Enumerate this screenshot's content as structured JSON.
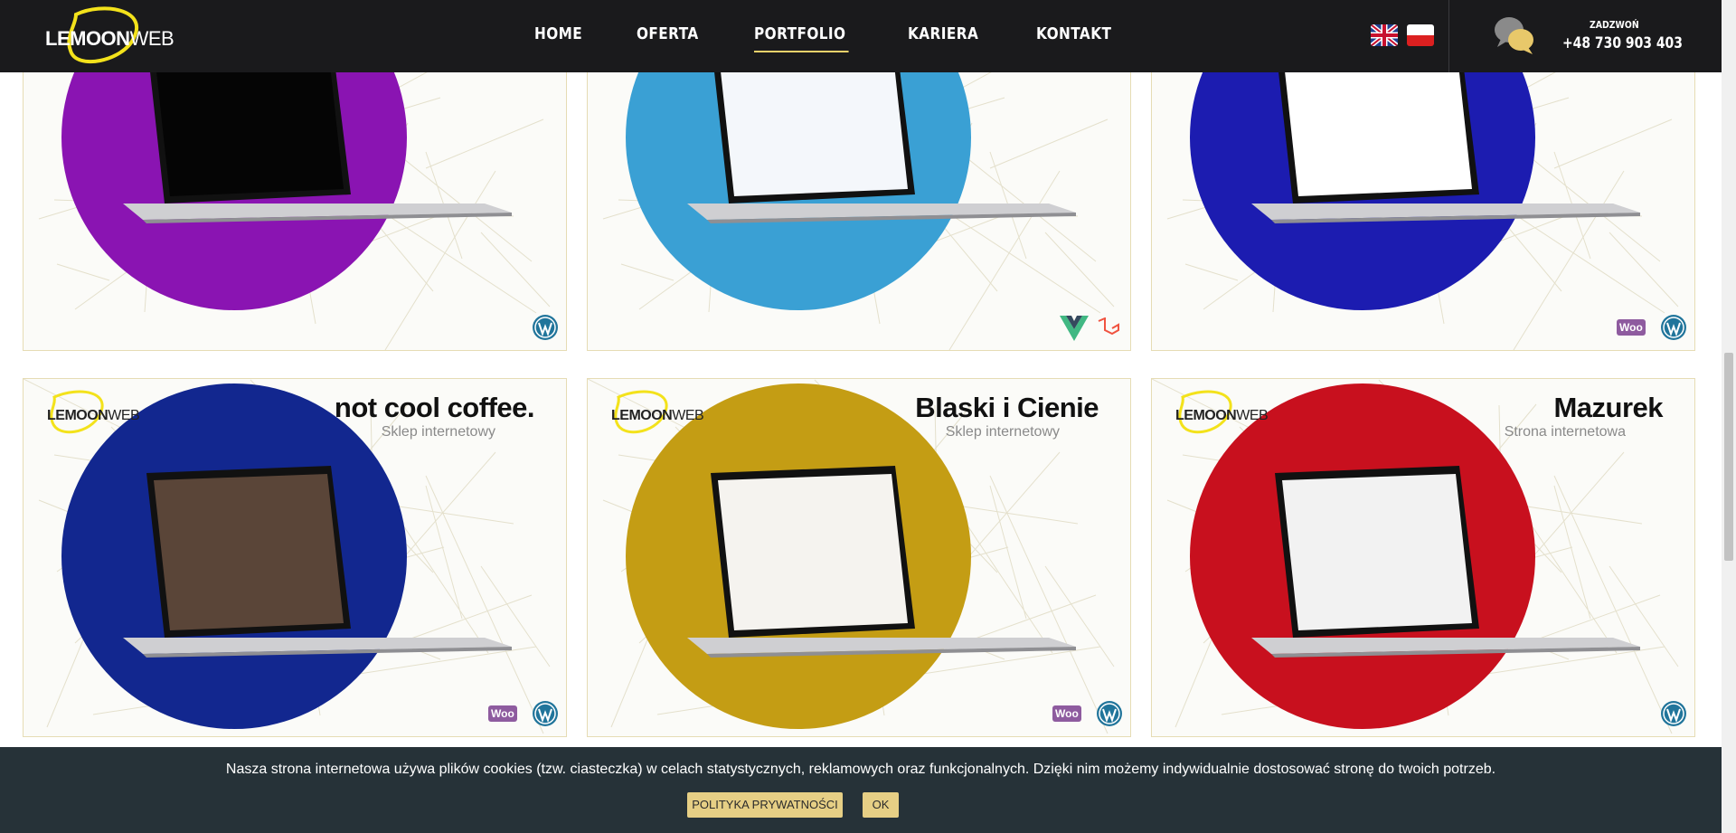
{
  "header": {
    "logo_text_bold": "LEMOON",
    "logo_text_thin": "WEB",
    "nav": [
      {
        "label": "HOME",
        "active": false
      },
      {
        "label": "OFERTA",
        "active": false
      },
      {
        "label": "PORTFOLIO",
        "active": true
      },
      {
        "label": "KARIERA",
        "active": false
      },
      {
        "label": "KONTAKT",
        "active": false
      }
    ],
    "languages": [
      "english-flag-icon",
      "polish-flag-icon"
    ],
    "call_label": "ZADZWOŃ",
    "phone": "+48 730 903 403",
    "accent_color": "#f2d26b"
  },
  "portfolio": {
    "cards": [
      {
        "title": "",
        "subtitle": "",
        "circle_color": "#8a14b2",
        "badges": [
          "wordpress-icon"
        ],
        "screen": "restaurant-reservation"
      },
      {
        "title": "",
        "subtitle": "",
        "circle_color": "#3aa0d4",
        "badges": [
          "vue-icon",
          "laravel-icon"
        ],
        "screen": "clinic-advisor"
      },
      {
        "title": "",
        "subtitle": "",
        "circle_color": "#1c1cb0",
        "badges": [
          "woocommerce-icon",
          "wordpress-icon"
        ],
        "screen": "polish-products"
      },
      {
        "title": "not cool coffee.",
        "subtitle": "Sklep internetowy",
        "circle_color": "#12278f",
        "badges": [
          "woocommerce-icon",
          "wordpress-icon"
        ],
        "screen": "coffee-shop"
      },
      {
        "title": "Blaski i Cienie",
        "subtitle": "Sklep internetowy",
        "circle_color": "#c49d14",
        "badges": [
          "woocommerce-icon",
          "wordpress-icon"
        ],
        "screen": "lamps-shop"
      },
      {
        "title": "Mazurek",
        "subtitle": "Strona internetowa",
        "circle_color": "#c8101e",
        "badges": [
          "wordpress-icon"
        ],
        "screen": "bakery-site"
      }
    ],
    "card_logo_bold": "LEMOON",
    "card_logo_thin": "WEB",
    "woo_label": "Woo"
  },
  "cookie_banner": {
    "text": "Nasza strona internetowa używa plików cookies (tzw. ciasteczka) w celach statystycznych, reklamowych oraz funkcjonalnych. Dzięki nim możemy indywidualnie dostosować stronę do twoich potrzeb.",
    "policy_button": "POLITYKA PRYWATNOŚCI",
    "ok_button": "OK"
  }
}
